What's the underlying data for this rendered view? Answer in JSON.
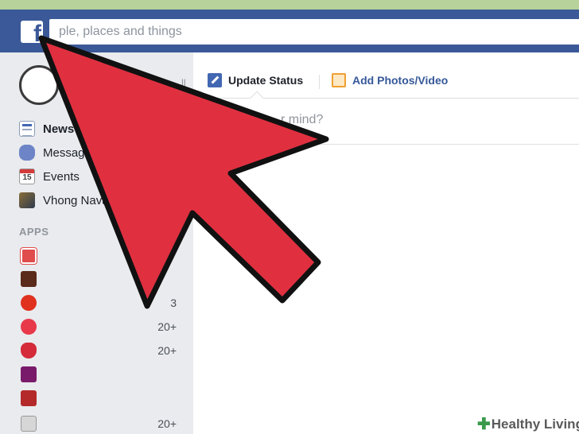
{
  "topbar": {
    "logo_letter": "f",
    "search_placeholder": "Search for people, places and things",
    "search_visible_text": "ple, places and things"
  },
  "sidebar": {
    "profile_edit_fragment": "ll",
    "nav": [
      {
        "label": "News Feed",
        "visible": "News",
        "icon": "news-feed-icon"
      },
      {
        "label": "Messages",
        "visible": "Messag",
        "icon": "messages-icon"
      },
      {
        "label": "Events",
        "visible": "Events",
        "icon": "events-calendar-icon",
        "icon_text": "15"
      },
      {
        "label": "Vhong Nava",
        "visible": "Vhong Nava",
        "icon": "group-photo-icon"
      }
    ],
    "apps_header": "APPS",
    "apps": [
      {
        "icon": "app-icon-1",
        "count": ""
      },
      {
        "icon": "app-icon-2",
        "count": ""
      },
      {
        "icon": "app-icon-3",
        "count": "3"
      },
      {
        "icon": "app-icon-4",
        "count": "20+"
      },
      {
        "icon": "app-icon-5",
        "count": "20+"
      },
      {
        "icon": "app-icon-6",
        "count": ""
      },
      {
        "icon": "app-icon-7",
        "count": ""
      },
      {
        "icon": "app-icon-8",
        "count": "20+"
      }
    ]
  },
  "composer": {
    "update_status": "Update Status",
    "add_photos": "Add Photos/Video",
    "prompt_visible": "r mind?"
  },
  "watermark": {
    "brand": "Healthy Living"
  },
  "colors": {
    "facebook_blue": "#3b5998",
    "arrow_red": "#e03040"
  }
}
